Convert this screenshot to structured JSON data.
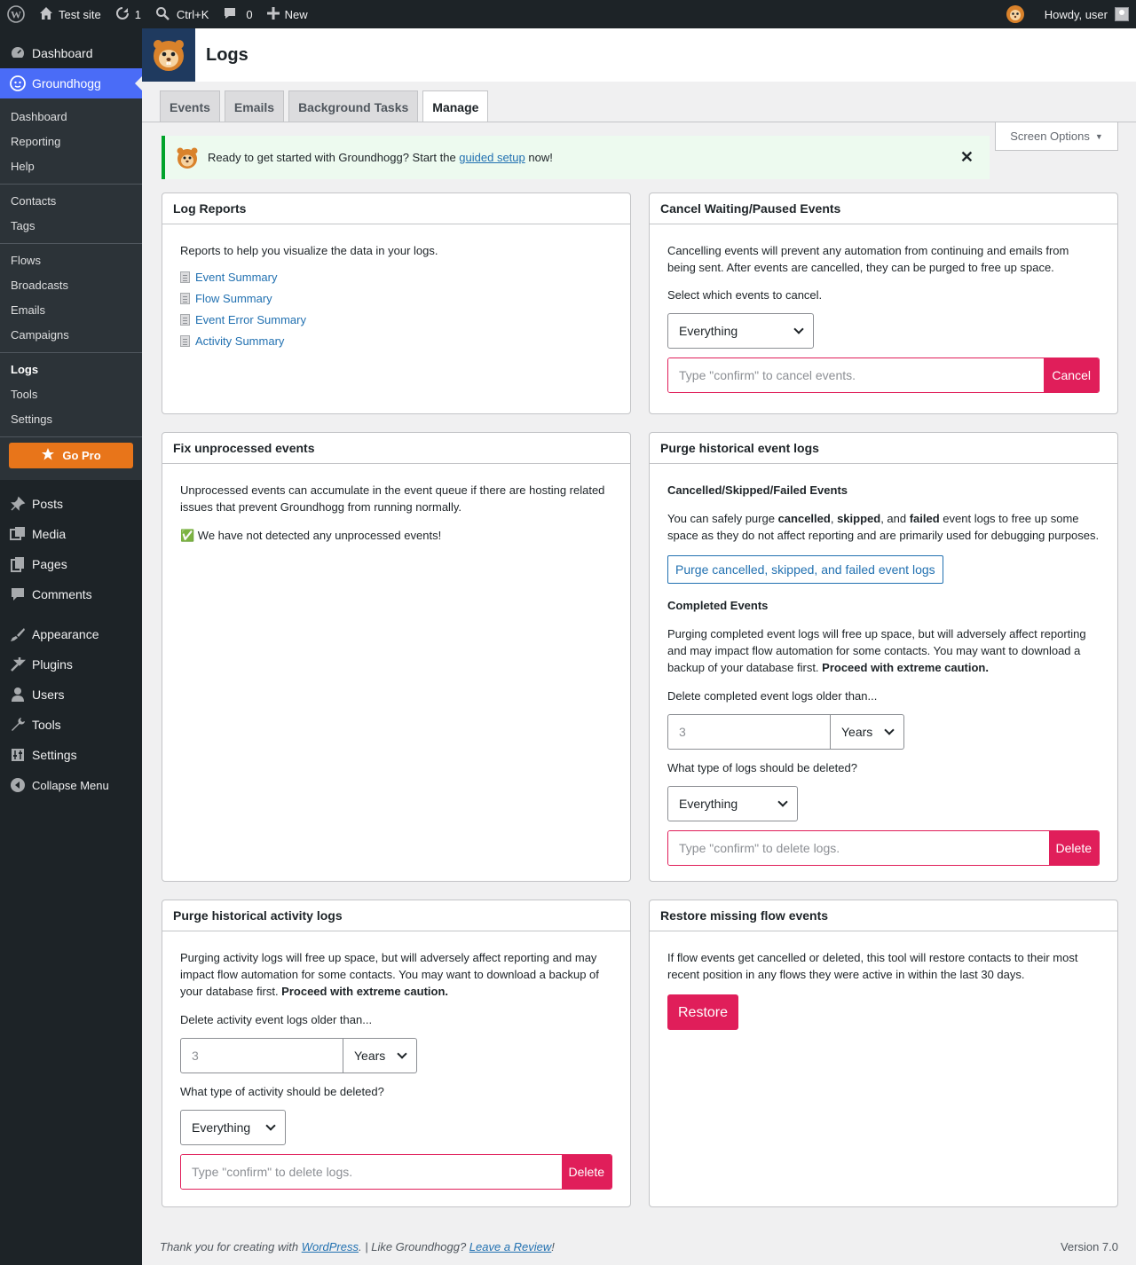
{
  "adminbar": {
    "site_name": "Test site",
    "updates_count": "1",
    "search_shortcut": "Ctrl+K",
    "comments_count": "0",
    "new_label": "New",
    "howdy": "Howdy, user"
  },
  "sidebar": {
    "top_items": [
      {
        "label": "Dashboard",
        "icon": "dashboard-icon"
      },
      {
        "label": "Groundhogg",
        "icon": "groundhogg-icon"
      }
    ],
    "submenu": [
      "Dashboard",
      "Reporting",
      "Help",
      "Contacts",
      "Tags",
      "Flows",
      "Broadcasts",
      "Emails",
      "Campaigns",
      "Logs",
      "Tools",
      "Settings"
    ],
    "go_pro": "Go Pro",
    "wp_items": [
      {
        "label": "Posts",
        "icon": "pin-icon"
      },
      {
        "label": "Media",
        "icon": "media-icon"
      },
      {
        "label": "Pages",
        "icon": "pages-icon"
      },
      {
        "label": "Comments",
        "icon": "comment-icon"
      },
      {
        "label": "Appearance",
        "icon": "brush-icon"
      },
      {
        "label": "Plugins",
        "icon": "plug-icon"
      },
      {
        "label": "Users",
        "icon": "user-icon"
      },
      {
        "label": "Tools",
        "icon": "wrench-icon"
      },
      {
        "label": "Settings",
        "icon": "sliders-icon"
      },
      {
        "label": "Collapse Menu",
        "icon": "collapse-icon"
      }
    ]
  },
  "header": {
    "title": "Logs"
  },
  "tabs": [
    "Events",
    "Emails",
    "Background Tasks",
    "Manage"
  ],
  "screen_options": "Screen Options",
  "notice": {
    "text_before": "Ready to get started with Groundhogg? Start the ",
    "link": "guided setup",
    "text_after": " now!",
    "close": "✕"
  },
  "log_reports": {
    "title": "Log Reports",
    "intro": "Reports to help you visualize the data in your logs.",
    "links": [
      "Event Summary",
      "Flow Summary",
      "Event Error Summary",
      "Activity Summary"
    ]
  },
  "cancel_events": {
    "title": "Cancel Waiting/Paused Events",
    "desc": "Cancelling events will prevent any automation from continuing and emails from being sent. After events are cancelled, they can be purged to free up space.",
    "select_label": "Select which events to cancel.",
    "select_value": "Everything",
    "placeholder": "Type \"confirm\" to cancel events.",
    "button": "Cancel"
  },
  "fix_unprocessed": {
    "title": "Fix unprocessed events",
    "desc": "Unprocessed events can accumulate in the event queue if there are hosting related issues that prevent Groundhogg from running normally.",
    "status": "✅ We have not detected any unprocessed events!"
  },
  "purge_events": {
    "title": "Purge historical event logs",
    "section1_title": "Cancelled/Skipped/Failed Events",
    "s1_a": "You can safely purge ",
    "s1_b": "cancelled",
    "s1_c": ", ",
    "s1_d": "skipped",
    "s1_e": ", and ",
    "s1_f": "failed",
    "s1_g": " event logs to free up some space as they do not affect reporting and are primarily used for debugging purposes.",
    "purge_button": "Purge cancelled, skipped, and failed event logs",
    "section2_title": "Completed Events",
    "s2_text": "Purging completed event logs will free up space, but will adversely affect reporting and may impact flow automation for some contacts. You may want to download a backup of your database first. ",
    "s2_bold": "Proceed with extreme caution.",
    "older_label": "Delete completed event logs older than...",
    "number": "3",
    "unit": "Years",
    "type_label": "What type of logs should be deleted?",
    "type_value": "Everything",
    "placeholder": "Type \"confirm\" to delete logs.",
    "button": "Delete"
  },
  "purge_activity": {
    "title": "Purge historical activity logs",
    "text": "Purging activity logs will free up space, but will adversely affect reporting and may impact flow automation for some contacts. You may want to download a backup of your database first. ",
    "bold": "Proceed with extreme caution.",
    "older_label": "Delete activity event logs older than...",
    "number": "3",
    "unit": "Years",
    "type_label": "What type of activity should be deleted?",
    "type_value": "Everything",
    "placeholder": "Type \"confirm\" to delete logs.",
    "button": "Delete"
  },
  "restore_flow": {
    "title": "Restore missing flow events",
    "desc": "If flow events get cancelled or deleted, this tool will restore contacts to their most recent position in any flows they were active in within the last 30 days.",
    "button": "Restore"
  },
  "footer": {
    "a": "Thank you for creating with ",
    "wp_link": "WordPress",
    "b": ". | Like Groundhogg? ",
    "review_link": "Leave a Review",
    "c": "!",
    "version": "Version 7.0"
  },
  "colors": {
    "accent": "#4a6cf7",
    "danger": "#e01e5a",
    "go_pro": "#e8751a",
    "link": "#2271b1"
  }
}
